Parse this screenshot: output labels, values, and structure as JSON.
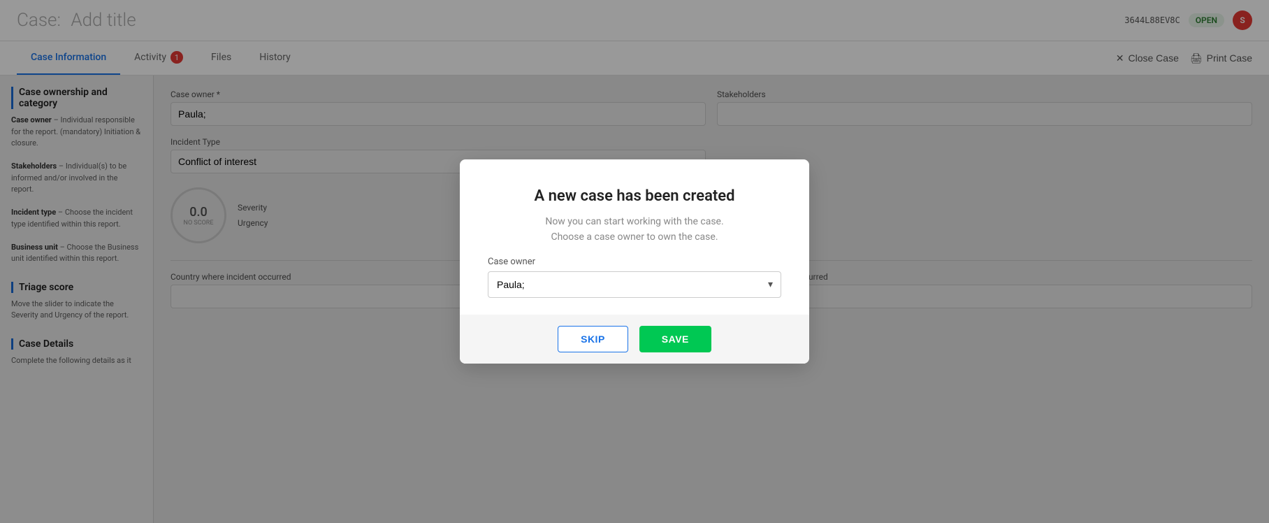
{
  "header": {
    "title_prefix": "Case:",
    "title_suffix": "Add title",
    "case_id": "3644L88EV8C",
    "status": "OPEN",
    "avatar_initials": "S"
  },
  "tabs": [
    {
      "label": "Case Information",
      "active": true,
      "badge": null
    },
    {
      "label": "Activity",
      "active": false,
      "badge": "1"
    },
    {
      "label": "Files",
      "active": false,
      "badge": null
    },
    {
      "label": "History",
      "active": false,
      "badge": null
    }
  ],
  "tabs_actions": {
    "close_case": "Close Case",
    "print_case": "Print Case"
  },
  "sidebar": {
    "sections": [
      {
        "title": "Case ownership and category",
        "body": "Case owner – Individual responsible for the report. (mandatory) Initiation & closure.\nStakeholders – Individual(s) to be informed and/or involved in the report.\nIncident type – Choose the incident type identified within this report.\nBusiness unit – Choose the Business unit identified within this report."
      },
      {
        "title": "Triage score",
        "body": "Move the slider to indicate the Severity and Urgency of the report."
      },
      {
        "title": "Case Details",
        "body": "Complete the following details as it"
      }
    ]
  },
  "form": {
    "case_owner_label": "Case owner *",
    "case_owner_value": "Paula;",
    "stakeholders_label": "Stakeholders",
    "incident_type_label": "Incident Type",
    "incident_type_value": "Conflict of interest",
    "country_label": "Country where incident occurred",
    "state_label": "State where incident occurred",
    "triage": {
      "score_value": "0.0",
      "score_no_score": "NO SCORE",
      "severity_label": "Severity",
      "urgency_label": "Urgency"
    }
  },
  "modal": {
    "title": "A new case has been created",
    "subtitle1": "Now you can start working with the case.",
    "subtitle2": "Choose a case owner to own the case.",
    "case_owner_label": "Case owner",
    "case_owner_value": "Paula;",
    "btn_skip": "SKIP",
    "btn_save": "SAVE"
  }
}
